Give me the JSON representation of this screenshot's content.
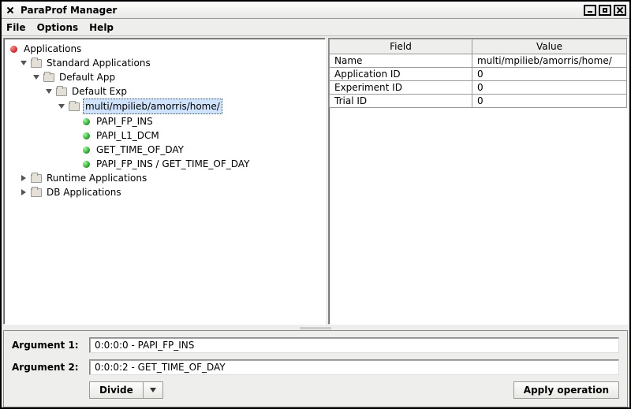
{
  "window": {
    "title": "ParaProf Manager"
  },
  "menubar": {
    "file": "File",
    "options": "Options",
    "help": "Help"
  },
  "tree": {
    "root": "Applications",
    "standard": "Standard Applications",
    "default_app": "Default App",
    "default_exp": "Default Exp",
    "trial": "multi/mpilieb/amorris/home/",
    "metrics": [
      "PAPI_FP_INS",
      "PAPI_L1_DCM",
      "GET_TIME_OF_DAY",
      "PAPI_FP_INS / GET_TIME_OF_DAY"
    ],
    "runtime": "Runtime Applications",
    "db": "DB Applications"
  },
  "table": {
    "headers": {
      "field": "Field",
      "value": "Value"
    },
    "rows": [
      {
        "field": "Name",
        "value": "multi/mpilieb/amorris/home/"
      },
      {
        "field": "Application ID",
        "value": "0"
      },
      {
        "field": "Experiment ID",
        "value": "0"
      },
      {
        "field": "Trial ID",
        "value": "0"
      }
    ]
  },
  "bottom": {
    "arg1_label": "Argument 1:",
    "arg1_value": "0:0:0:0 - PAPI_FP_INS",
    "arg2_label": "Argument 2:",
    "arg2_value": "0:0:0:2 - GET_TIME_OF_DAY",
    "operation": "Divide",
    "apply": "Apply operation"
  }
}
